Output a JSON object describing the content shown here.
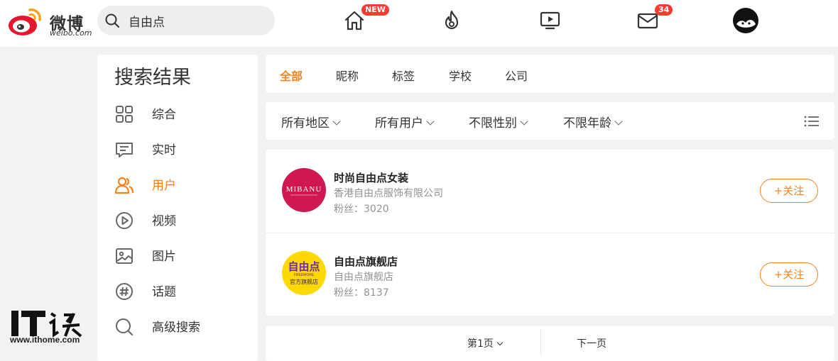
{
  "header": {
    "logo_text": "微博",
    "logo_sub": "weibo.com",
    "search_value": "自由点",
    "nav": [
      {
        "name": "home",
        "badge": "NEW"
      },
      {
        "name": "hot",
        "badge": ""
      },
      {
        "name": "video",
        "badge": ""
      },
      {
        "name": "messages",
        "badge": "34"
      },
      {
        "name": "profile",
        "badge": ""
      }
    ]
  },
  "sidebar": {
    "title": "搜索结果",
    "items": [
      {
        "label": "综合",
        "icon": "grid-icon",
        "active": false
      },
      {
        "label": "实时",
        "icon": "chat-icon",
        "active": false
      },
      {
        "label": "用户",
        "icon": "users-icon",
        "active": true
      },
      {
        "label": "视频",
        "icon": "play-icon",
        "active": false
      },
      {
        "label": "图片",
        "icon": "image-icon",
        "active": false
      },
      {
        "label": "话题",
        "icon": "hashtag-icon",
        "active": false
      },
      {
        "label": "高级搜索",
        "icon": "search-icon",
        "active": false
      }
    ]
  },
  "tabs": [
    {
      "label": "全部",
      "active": true
    },
    {
      "label": "昵称",
      "active": false
    },
    {
      "label": "标签",
      "active": false
    },
    {
      "label": "学校",
      "active": false
    },
    {
      "label": "公司",
      "active": false
    }
  ],
  "filters": [
    {
      "label": "所有地区"
    },
    {
      "label": "所有用户"
    },
    {
      "label": "不限性别"
    },
    {
      "label": "不限年龄"
    }
  ],
  "results": [
    {
      "name": "时尚自由点女装",
      "desc": "香港自由点服饰有限公司",
      "fans": "粉丝：3020",
      "follow": "+关注",
      "avatar_text": "MIBANU",
      "avatar_color": "#d0174f"
    },
    {
      "name": "自由点旗舰店",
      "desc": "自由点旗舰店",
      "fans": "粉丝：8137",
      "follow": "+关注",
      "avatar_text": "自由点",
      "avatar_sub": "FREEMORE",
      "avatar_foot": "官方旗舰店",
      "avatar_color": "#ffd800"
    }
  ],
  "pager": {
    "current": "第1页",
    "next": "下一页"
  },
  "watermark": {
    "text": "IT之家",
    "url": "www.ithome.com"
  },
  "colors": {
    "accent": "#f7821c",
    "badge": "#ff3b2f",
    "weibo_red": "#e6162d"
  }
}
